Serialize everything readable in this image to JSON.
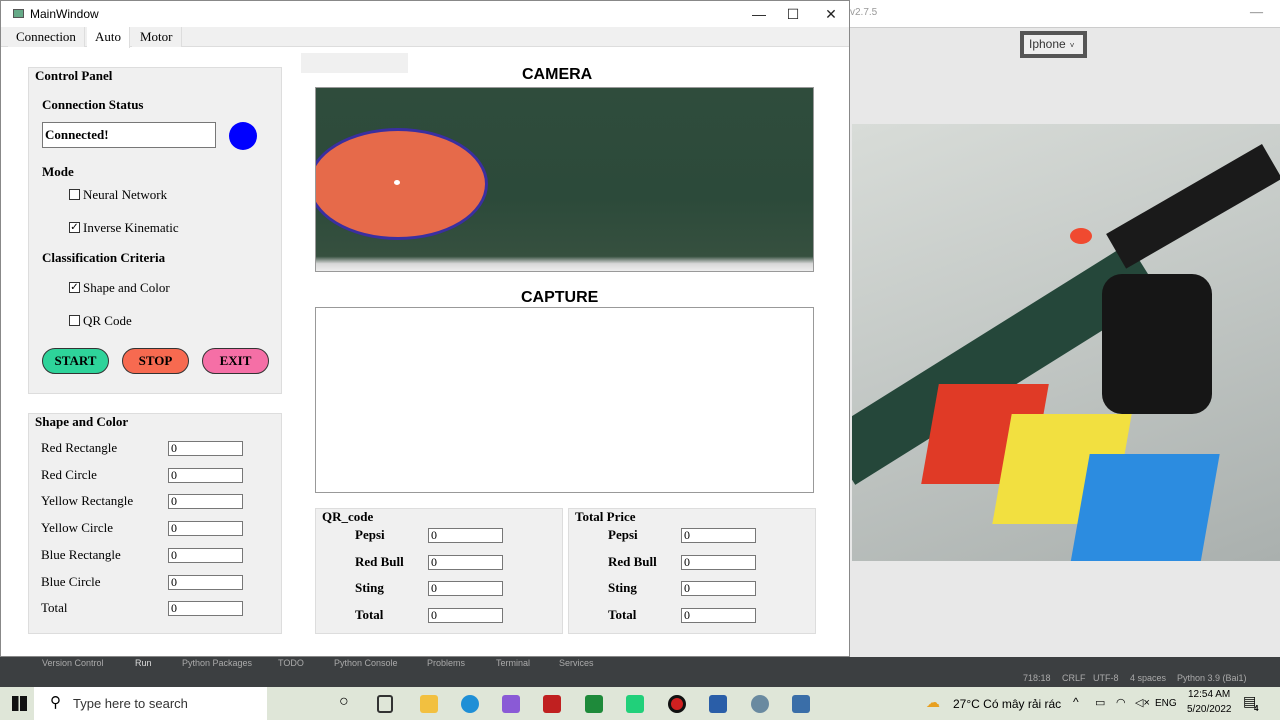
{
  "window": {
    "title": "MainWindow",
    "minimize": "—",
    "maximize": "☐",
    "close": "✕"
  },
  "tabs": [
    {
      "label": "Connection"
    },
    {
      "label": "Auto"
    },
    {
      "label": "Motor"
    }
  ],
  "control_panel": {
    "title": "Control Panel",
    "connection_status_label": "Connection Status",
    "connection_status_value": "Connected!",
    "status_color": "#0000ff",
    "mode_label": "Mode",
    "mode_options": [
      {
        "label": "Neural Network",
        "checked": false
      },
      {
        "label": "Inverse Kinematic",
        "checked": true
      }
    ],
    "criteria_label": "Classification Criteria",
    "criteria_options": [
      {
        "label": "Shape and Color",
        "checked": true
      },
      {
        "label": "QR Code",
        "checked": false
      }
    ],
    "buttons": {
      "start": "START",
      "stop": "STOP",
      "exit": "EXIT"
    },
    "button_colors": {
      "start": "#2ed39a",
      "stop": "#f76a50",
      "exit": "#f56fa6"
    }
  },
  "shape_color": {
    "title": "Shape and Color",
    "rows": [
      {
        "label": "Red Rectangle",
        "value": "0"
      },
      {
        "label": "Red Circle",
        "value": "0"
      },
      {
        "label": "Yellow Rectangle",
        "value": "0"
      },
      {
        "label": "Yellow Circle",
        "value": "0"
      },
      {
        "label": "Blue Rectangle",
        "value": "0"
      },
      {
        "label": "Blue Circle",
        "value": "0"
      },
      {
        "label": "Total",
        "value": "0"
      }
    ]
  },
  "camera": {
    "title": "CAMERA"
  },
  "capture": {
    "title": "CAPTURE"
  },
  "qr_code": {
    "title": "QR_code",
    "rows": [
      {
        "label": "Pepsi",
        "value": "0"
      },
      {
        "label": "Red Bull",
        "value": "0"
      },
      {
        "label": "Sting",
        "value": "0"
      },
      {
        "label": "Total",
        "value": "0"
      }
    ]
  },
  "total_price": {
    "title": "Total Price",
    "rows": [
      {
        "label": "Pepsi",
        "value": "0"
      },
      {
        "label": "Red Bull",
        "value": "0"
      },
      {
        "label": "Sting",
        "value": "0"
      },
      {
        "label": "Total",
        "value": "0"
      }
    ]
  },
  "camera_app": {
    "version": "v2.7.5",
    "device_select": "Iphone",
    "minimize": "—"
  },
  "ide": {
    "tools": [
      "Version Control",
      "Run",
      "Python Packages",
      "TODO",
      "Python Console",
      "Problems",
      "Terminal",
      "Services"
    ],
    "status": [
      "718:18",
      "CRLF",
      "UTF-8",
      "4 spaces",
      "Python 3.9 (Bai1)"
    ]
  },
  "taskbar": {
    "search_placeholder": "Type here to search",
    "weather": "27°C  Có mây rải rác",
    "language": "ENG",
    "time": "12:54 AM",
    "date": "5/20/2022",
    "notifications": "4"
  }
}
